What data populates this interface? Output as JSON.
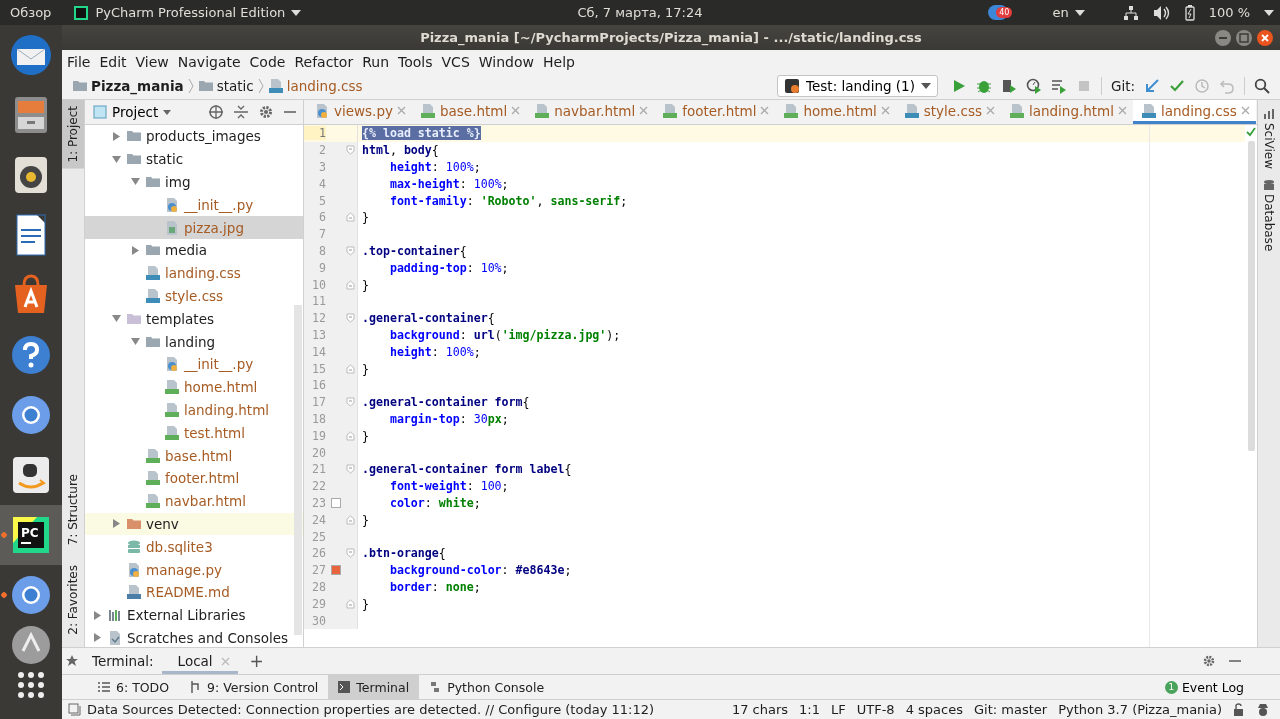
{
  "top_panel": {
    "activities": "Обзор",
    "app_menu": "PyCharm Professional Edition",
    "clock": "Сб, 7 марта, 17:24",
    "notification_count": "40",
    "keyboard_layout": "en",
    "battery": "100 %"
  },
  "dock": [
    {
      "kind": "mail",
      "running": false,
      "selected": false
    },
    {
      "kind": "files",
      "running": false,
      "selected": false
    },
    {
      "kind": "music",
      "running": false,
      "selected": false
    },
    {
      "kind": "writer",
      "running": false,
      "selected": false
    },
    {
      "kind": "store",
      "running": false,
      "selected": false
    },
    {
      "kind": "help",
      "running": false,
      "selected": false
    },
    {
      "kind": "browser",
      "running": false,
      "selected": false
    },
    {
      "kind": "shop",
      "running": false,
      "selected": false
    },
    {
      "kind": "ide",
      "glyph": "PC",
      "running": true,
      "selected": true
    },
    {
      "kind": "browser",
      "running": true,
      "selected": false
    },
    {
      "kind": "updater",
      "running": false,
      "selected": false
    },
    {
      "kind": "apps",
      "running": false,
      "selected": false
    }
  ],
  "window": {
    "title": "Pizza_mania [~/PycharmProjects/Pizza_mania] - .../static/landing.css"
  },
  "menu": [
    "File",
    "Edit",
    "View",
    "Navigate",
    "Code",
    "Refactor",
    "Run",
    "Tools",
    "VCS",
    "Window",
    "Help"
  ],
  "breadcrumbs": [
    {
      "label": "Pizza_mania",
      "kind": "project"
    },
    {
      "label": "static",
      "kind": "folder"
    },
    {
      "label": "landing.css",
      "kind": "css"
    }
  ],
  "run_config": "Test: landing (1)",
  "git_label": "Git:",
  "left_stripe": [
    {
      "label": "1: Project",
      "selected": true
    },
    {
      "label": "7: Structure",
      "selected": false
    },
    {
      "label": "2: Favorites",
      "selected": false
    }
  ],
  "right_stripe": [
    {
      "label": "SciView"
    },
    {
      "label": "Database"
    }
  ],
  "project_panel": {
    "title": "Project",
    "tree": [
      {
        "label": "products_images",
        "kind": "folder",
        "expanded": false,
        "selected": false
      },
      {
        "label": "static",
        "kind": "folder",
        "expanded": true,
        "selected": false,
        "children": [
          {
            "label": "img",
            "kind": "folder",
            "expanded": true,
            "selected": false,
            "children": [
              {
                "label": "__init__.py",
                "kind": "py",
                "selected": false
              },
              {
                "label": "pizza.jpg",
                "kind": "image",
                "selected": true
              }
            ]
          },
          {
            "label": "media",
            "kind": "folder",
            "expanded": false,
            "selected": false
          },
          {
            "label": "landing.css",
            "kind": "css",
            "selected": false
          },
          {
            "label": "style.css",
            "kind": "css",
            "selected": false
          }
        ]
      },
      {
        "label": "templates",
        "kind": "template-folder",
        "expanded": true,
        "selected": false,
        "children": [
          {
            "label": "landing",
            "kind": "folder",
            "expanded": true,
            "selected": false,
            "children": [
              {
                "label": "__init__.py",
                "kind": "py",
                "selected": false
              },
              {
                "label": "home.html",
                "kind": "html",
                "selected": false
              },
              {
                "label": "landing.html",
                "kind": "html",
                "selected": false
              },
              {
                "label": "test.html",
                "kind": "html",
                "selected": false
              }
            ]
          },
          {
            "label": "base.html",
            "kind": "html",
            "selected": false
          },
          {
            "label": "footer.html",
            "kind": "html",
            "selected": false
          },
          {
            "label": "navbar.html",
            "kind": "html",
            "selected": false
          }
        ]
      },
      {
        "label": "venv",
        "kind": "excluded-folder",
        "expanded": false,
        "selected": false
      },
      {
        "label": "db.sqlite3",
        "kind": "db",
        "selected": false
      },
      {
        "label": "manage.py",
        "kind": "py",
        "selected": false
      },
      {
        "label": "README.md",
        "kind": "md",
        "selected": false
      },
      {
        "label": "External Libraries",
        "kind": "library",
        "expanded": false,
        "selected": false
      },
      {
        "label": "Scratches and Consoles",
        "kind": "scratches",
        "expanded": false,
        "selected": false
      }
    ]
  },
  "tabs": [
    {
      "label": "views.py",
      "kind": "py",
      "selected": false
    },
    {
      "label": "base.html",
      "kind": "html",
      "selected": false
    },
    {
      "label": "navbar.html",
      "kind": "html",
      "selected": false
    },
    {
      "label": "footer.html",
      "kind": "html",
      "selected": false
    },
    {
      "label": "home.html",
      "kind": "html",
      "selected": false
    },
    {
      "label": "style.css",
      "kind": "css",
      "selected": false
    },
    {
      "label": "landing.html",
      "kind": "html",
      "selected": false
    },
    {
      "label": "landing.css",
      "kind": "css",
      "selected": true
    }
  ],
  "editor": {
    "lines": [
      {
        "number": "1",
        "kind": "plain",
        "current": true,
        "indented": false,
        "tokens": [
          {
            "kind": "selection",
            "text": "{% load static %}"
          }
        ]
      },
      {
        "number": "2",
        "kind": "block-start",
        "current": false,
        "indented": false,
        "tokens": [
          {
            "kind": "selector",
            "text": "html"
          },
          {
            "kind": "punct",
            "text": ", "
          },
          {
            "kind": "selector",
            "text": "body"
          },
          {
            "kind": "punct",
            "text": "{"
          }
        ]
      },
      {
        "number": "3",
        "kind": "plain",
        "current": false,
        "indented": true,
        "tokens": [
          {
            "kind": "property",
            "text": "height"
          },
          {
            "kind": "punct",
            "text": ": "
          },
          {
            "kind": "number",
            "text": "100%"
          },
          {
            "kind": "punct",
            "text": ";"
          }
        ]
      },
      {
        "number": "4",
        "kind": "plain",
        "current": false,
        "indented": true,
        "tokens": [
          {
            "kind": "property",
            "text": "max-height"
          },
          {
            "kind": "punct",
            "text": ": "
          },
          {
            "kind": "number",
            "text": "100%"
          },
          {
            "kind": "punct",
            "text": ";"
          }
        ]
      },
      {
        "number": "5",
        "kind": "plain",
        "current": false,
        "indented": true,
        "tokens": [
          {
            "kind": "property",
            "text": "font-family"
          },
          {
            "kind": "punct",
            "text": ": "
          },
          {
            "kind": "string",
            "text": "'Roboto'"
          },
          {
            "kind": "punct",
            "text": ", "
          },
          {
            "kind": "keyword",
            "text": "sans-serif"
          },
          {
            "kind": "punct",
            "text": ";"
          }
        ]
      },
      {
        "number": "6",
        "kind": "block-end",
        "current": false,
        "indented": false,
        "tokens": [
          {
            "kind": "punct",
            "text": "}"
          }
        ]
      },
      {
        "number": "7",
        "kind": "plain",
        "current": false
      },
      {
        "number": "8",
        "kind": "block-start",
        "current": false,
        "indented": false,
        "tokens": [
          {
            "kind": "selector",
            "text": ".top-container"
          },
          {
            "kind": "punct",
            "text": "{"
          }
        ]
      },
      {
        "number": "9",
        "kind": "plain",
        "current": false,
        "indented": true,
        "tokens": [
          {
            "kind": "property",
            "text": "padding-top"
          },
          {
            "kind": "punct",
            "text": ": "
          },
          {
            "kind": "number",
            "text": "10%"
          },
          {
            "kind": "punct",
            "text": ";"
          }
        ]
      },
      {
        "number": "10",
        "kind": "block-end",
        "current": false,
        "indented": false,
        "tokens": [
          {
            "kind": "punct",
            "text": "}"
          }
        ]
      },
      {
        "number": "11",
        "kind": "plain",
        "current": false
      },
      {
        "number": "12",
        "kind": "block-start",
        "current": false,
        "indented": false,
        "tokens": [
          {
            "kind": "selector",
            "text": ".general-container"
          },
          {
            "kind": "punct",
            "text": "{"
          }
        ]
      },
      {
        "number": "13",
        "kind": "plain",
        "current": false,
        "indented": true,
        "tokens": [
          {
            "kind": "property",
            "text": "background"
          },
          {
            "kind": "punct",
            "text": ": "
          },
          {
            "kind": "function",
            "text": "url"
          },
          {
            "kind": "punct",
            "text": "("
          },
          {
            "kind": "string",
            "text": "'img/pizza.jpg'"
          },
          {
            "kind": "punct",
            "text": ");"
          }
        ]
      },
      {
        "number": "14",
        "kind": "plain",
        "current": false,
        "indented": true,
        "tokens": [
          {
            "kind": "property",
            "text": "height"
          },
          {
            "kind": "punct",
            "text": ": "
          },
          {
            "kind": "number",
            "text": "100%"
          },
          {
            "kind": "punct",
            "text": ";"
          }
        ]
      },
      {
        "number": "15",
        "kind": "block-end",
        "current": false,
        "indented": false,
        "tokens": [
          {
            "kind": "punct",
            "text": "}"
          }
        ]
      },
      {
        "number": "16",
        "kind": "plain",
        "current": false
      },
      {
        "number": "17",
        "kind": "block-start",
        "current": false,
        "indented": false,
        "tokens": [
          {
            "kind": "selector",
            "text": ".general-container form"
          },
          {
            "kind": "punct",
            "text": "{"
          }
        ]
      },
      {
        "number": "18",
        "kind": "plain",
        "current": false,
        "indented": true,
        "tokens": [
          {
            "kind": "property",
            "text": "margin-top"
          },
          {
            "kind": "punct",
            "text": ": "
          },
          {
            "kind": "number",
            "text": "30"
          },
          {
            "kind": "keyword",
            "text": "px"
          },
          {
            "kind": "punct",
            "text": ";"
          }
        ]
      },
      {
        "number": "19",
        "kind": "block-end",
        "current": false,
        "indented": false,
        "tokens": [
          {
            "kind": "punct",
            "text": "}"
          }
        ]
      },
      {
        "number": "20",
        "kind": "plain",
        "current": false
      },
      {
        "number": "21",
        "kind": "block-start",
        "current": false,
        "indented": false,
        "tokens": [
          {
            "kind": "selector",
            "text": ".general-container form label"
          },
          {
            "kind": "punct",
            "text": "{"
          }
        ]
      },
      {
        "number": "22",
        "kind": "plain",
        "current": false,
        "indented": true,
        "tokens": [
          {
            "kind": "property",
            "text": "font-weight"
          },
          {
            "kind": "punct",
            "text": ": "
          },
          {
            "kind": "number",
            "text": "100"
          },
          {
            "kind": "punct",
            "text": ";"
          }
        ]
      },
      {
        "number": "23",
        "kind": "plain",
        "current": false,
        "indented": true,
        "color": "#ffffff",
        "tokens": [
          {
            "kind": "property",
            "text": "color"
          },
          {
            "kind": "punct",
            "text": ": "
          },
          {
            "kind": "keyword",
            "text": "white"
          },
          {
            "kind": "punct",
            "text": ";"
          }
        ]
      },
      {
        "number": "24",
        "kind": "block-end",
        "current": false,
        "indented": false,
        "tokens": [
          {
            "kind": "punct",
            "text": "}"
          }
        ]
      },
      {
        "number": "25",
        "kind": "plain",
        "current": false
      },
      {
        "number": "26",
        "kind": "block-start",
        "current": false,
        "indented": false,
        "tokens": [
          {
            "kind": "selector",
            "text": ".btn-orange"
          },
          {
            "kind": "punct",
            "text": "{"
          }
        ]
      },
      {
        "number": "27",
        "kind": "plain",
        "current": false,
        "indented": true,
        "color": "#e8643e",
        "tokens": [
          {
            "kind": "property",
            "text": "background-color"
          },
          {
            "kind": "punct",
            "text": ": "
          },
          {
            "kind": "hex",
            "text": "#e8643e"
          },
          {
            "kind": "punct",
            "text": ";"
          }
        ]
      },
      {
        "number": "28",
        "kind": "plain",
        "current": false,
        "indented": true,
        "tokens": [
          {
            "kind": "property",
            "text": "border"
          },
          {
            "kind": "punct",
            "text": ": "
          },
          {
            "kind": "keyword",
            "text": "none"
          },
          {
            "kind": "punct",
            "text": ";"
          }
        ]
      },
      {
        "number": "29",
        "kind": "block-end",
        "current": false,
        "indented": false,
        "tokens": [
          {
            "kind": "punct",
            "text": "}"
          }
        ]
      },
      {
        "number": "30",
        "kind": "plain",
        "current": false
      }
    ]
  },
  "terminal": {
    "label": "Terminal:",
    "tabs": [
      {
        "label": "Local",
        "selected": true
      }
    ],
    "add": "+"
  },
  "tool_windows": [
    {
      "label": "6: TODO",
      "kind": "todo",
      "selected": false
    },
    {
      "label": "9: Version Control",
      "kind": "vcs",
      "selected": false
    },
    {
      "label": "Terminal",
      "kind": "terminal",
      "selected": true
    },
    {
      "label": "Python Console",
      "kind": "console",
      "selected": false
    }
  ],
  "event_log": {
    "label": "Event Log",
    "count": "1"
  },
  "status_bar": {
    "message": "Data Sources Detected: Connection properties are detected. // Configure (today 11:12)",
    "items": [
      "17 chars",
      "1:1",
      "LF",
      "UTF-8",
      "4 spaces",
      "Git: master",
      "Python 3.7 (Pizza_mania)"
    ]
  }
}
